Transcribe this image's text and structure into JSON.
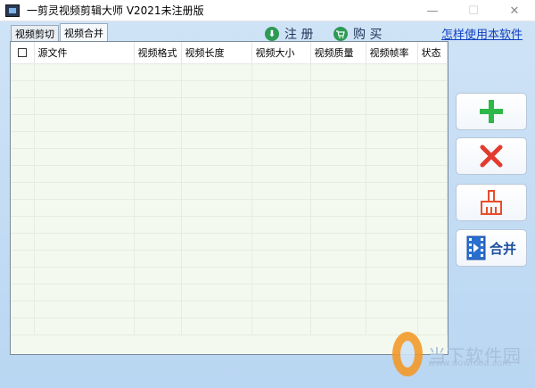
{
  "window": {
    "title": "一剪灵视频剪辑大师 V2021未注册版",
    "minimize": "—",
    "maximize": "☐",
    "close": "✕"
  },
  "tabs": [
    {
      "label": "视频剪切",
      "active": false
    },
    {
      "label": "视频合并",
      "active": true
    }
  ],
  "toolbar": {
    "register_label": "注 册",
    "buy_label": "购 买",
    "help_link": "怎样使用本软件"
  },
  "table": {
    "columns": [
      "源文件",
      "视频格式",
      "视频长度",
      "视频大小",
      "视频质量",
      "视频帧率",
      "状态"
    ],
    "rows": []
  },
  "side_buttons": {
    "merge_label": "合并"
  },
  "watermark": {
    "text": "当下软件园",
    "url": "www.downxia.com"
  },
  "colors": {
    "add": "#2fb84a",
    "remove": "#e23b2e",
    "clear": "#e94d2b",
    "merge_text": "#1f4fa0"
  }
}
